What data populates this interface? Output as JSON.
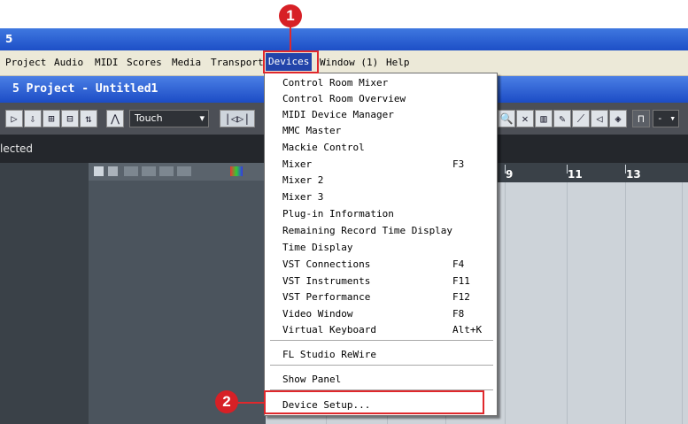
{
  "app": {
    "title": "5"
  },
  "menubar": {
    "items": [
      {
        "label": "Project"
      },
      {
        "label": "Audio"
      },
      {
        "label": "MIDI"
      },
      {
        "label": "Scores"
      },
      {
        "label": "Media"
      },
      {
        "label": "Transport"
      },
      {
        "label": "Devices"
      },
      {
        "label": "Window (1)"
      },
      {
        "label": "Help"
      }
    ]
  },
  "project_window": {
    "title": "5 Project - Untitled1"
  },
  "toolbar": {
    "automation_mode": "Touch",
    "right_selector": "-"
  },
  "status": {
    "selection_text": "lected"
  },
  "ruler": {
    "numbers": [
      "9",
      "11",
      "13"
    ]
  },
  "devices_menu": {
    "items": [
      {
        "label": "Control Room Mixer",
        "shortcut": ""
      },
      {
        "label": "Control Room Overview",
        "shortcut": ""
      },
      {
        "label": "MIDI Device Manager",
        "shortcut": ""
      },
      {
        "label": "MMC Master",
        "shortcut": ""
      },
      {
        "label": "Mackie Control",
        "shortcut": ""
      },
      {
        "label": "Mixer",
        "shortcut": "F3"
      },
      {
        "label": "Mixer 2",
        "shortcut": ""
      },
      {
        "label": "Mixer 3",
        "shortcut": ""
      },
      {
        "label": "Plug-in Information",
        "shortcut": ""
      },
      {
        "label": "Remaining Record Time Display",
        "shortcut": ""
      },
      {
        "label": "Time Display",
        "shortcut": ""
      },
      {
        "label": "VST Connections",
        "shortcut": "F4"
      },
      {
        "label": "VST Instruments",
        "shortcut": "F11"
      },
      {
        "label": "VST Performance",
        "shortcut": "F12"
      },
      {
        "label": "Video Window",
        "shortcut": "F8"
      },
      {
        "label": "Virtual Keyboard",
        "shortcut": "Alt+K"
      },
      {
        "label": "FL Studio ReWire",
        "shortcut": ""
      },
      {
        "label": "Show Panel",
        "shortcut": ""
      },
      {
        "label": "Device Setup...",
        "shortcut": ""
      }
    ]
  },
  "callouts": {
    "step1": "1",
    "step2": "2"
  },
  "colors": {
    "callout_red": "#e0282c",
    "title_blue": "#1d4fc7",
    "menu_highlight": "#2244aa"
  }
}
